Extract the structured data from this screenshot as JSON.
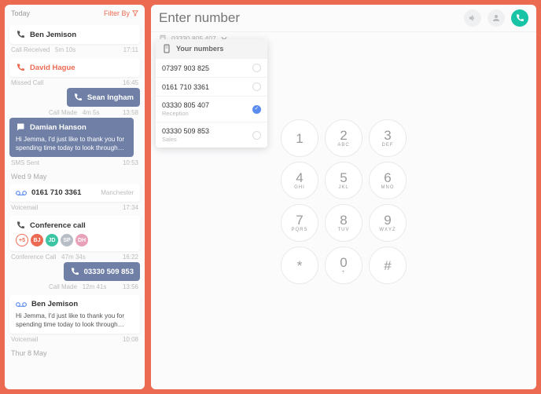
{
  "sidebar": {
    "today": "Today",
    "filter": "Filter By",
    "item1": {
      "name": "Ben Jemison",
      "status": "Call Received",
      "duration": "5m 10s",
      "time": "17:11"
    },
    "item2": {
      "name": "David Hague",
      "status": "Missed Call",
      "time": "16:45"
    },
    "item3": {
      "name": "Sean Ingham",
      "status": "Call Made",
      "duration": "4m 5s",
      "time": "13:58"
    },
    "item4": {
      "name": "Damian Hanson",
      "text": "Hi Jemma, I'd just like to thank you for spending time today to look through the...",
      "status": "SMS Sent",
      "time": "10:53"
    },
    "day1": "Wed 9 May",
    "item5": {
      "number": "0161 710 3361",
      "location": "Manchester",
      "status": "Voicemail",
      "time": "17:34"
    },
    "item6": {
      "title": "Conference call",
      "chips": [
        {
          "label": "+5",
          "bg": "plus"
        },
        {
          "label": "BJ",
          "bg": "#ed6a52"
        },
        {
          "label": "JD",
          "bg": "#3cc5a3"
        },
        {
          "label": "SP",
          "bg": "#b8bec6"
        },
        {
          "label": "DH",
          "bg": "#e8a1b8"
        }
      ],
      "status": "Conference Call",
      "duration": "47m 34s",
      "time": "16:22"
    },
    "item7": {
      "number": "03330 509 853",
      "status": "Call Made",
      "duration": "12m 41s",
      "time": "13:56"
    },
    "item8": {
      "name": "Ben Jemison",
      "text": "Hi Jemma, I'd just like to thank you for spending time today to look through the...",
      "status": "Voicemail",
      "time": "10:08"
    },
    "day2": "Thur 8 May"
  },
  "dialer": {
    "placeholder": "Enter number",
    "selected": "03330 805 407",
    "dropdown": {
      "header": "Your numbers",
      "items": [
        {
          "num": "07397 903 825",
          "sub": "",
          "on": false
        },
        {
          "num": "0161 710 3361",
          "sub": "",
          "on": false
        },
        {
          "num": "03330 805 407",
          "sub": "Reception",
          "on": true
        },
        {
          "num": "03330 509 853",
          "sub": "Sales",
          "on": false
        }
      ]
    },
    "keys": [
      {
        "d": "1",
        "l": ""
      },
      {
        "d": "2",
        "l": "ABC"
      },
      {
        "d": "3",
        "l": "DEF"
      },
      {
        "d": "4",
        "l": "GHI"
      },
      {
        "d": "5",
        "l": "JKL"
      },
      {
        "d": "6",
        "l": "MNO"
      },
      {
        "d": "7",
        "l": "PQRS"
      },
      {
        "d": "8",
        "l": "TUV"
      },
      {
        "d": "9",
        "l": "WXYZ"
      },
      {
        "d": "*",
        "l": ""
      },
      {
        "d": "0",
        "l": "+"
      },
      {
        "d": "#",
        "l": ""
      }
    ]
  }
}
